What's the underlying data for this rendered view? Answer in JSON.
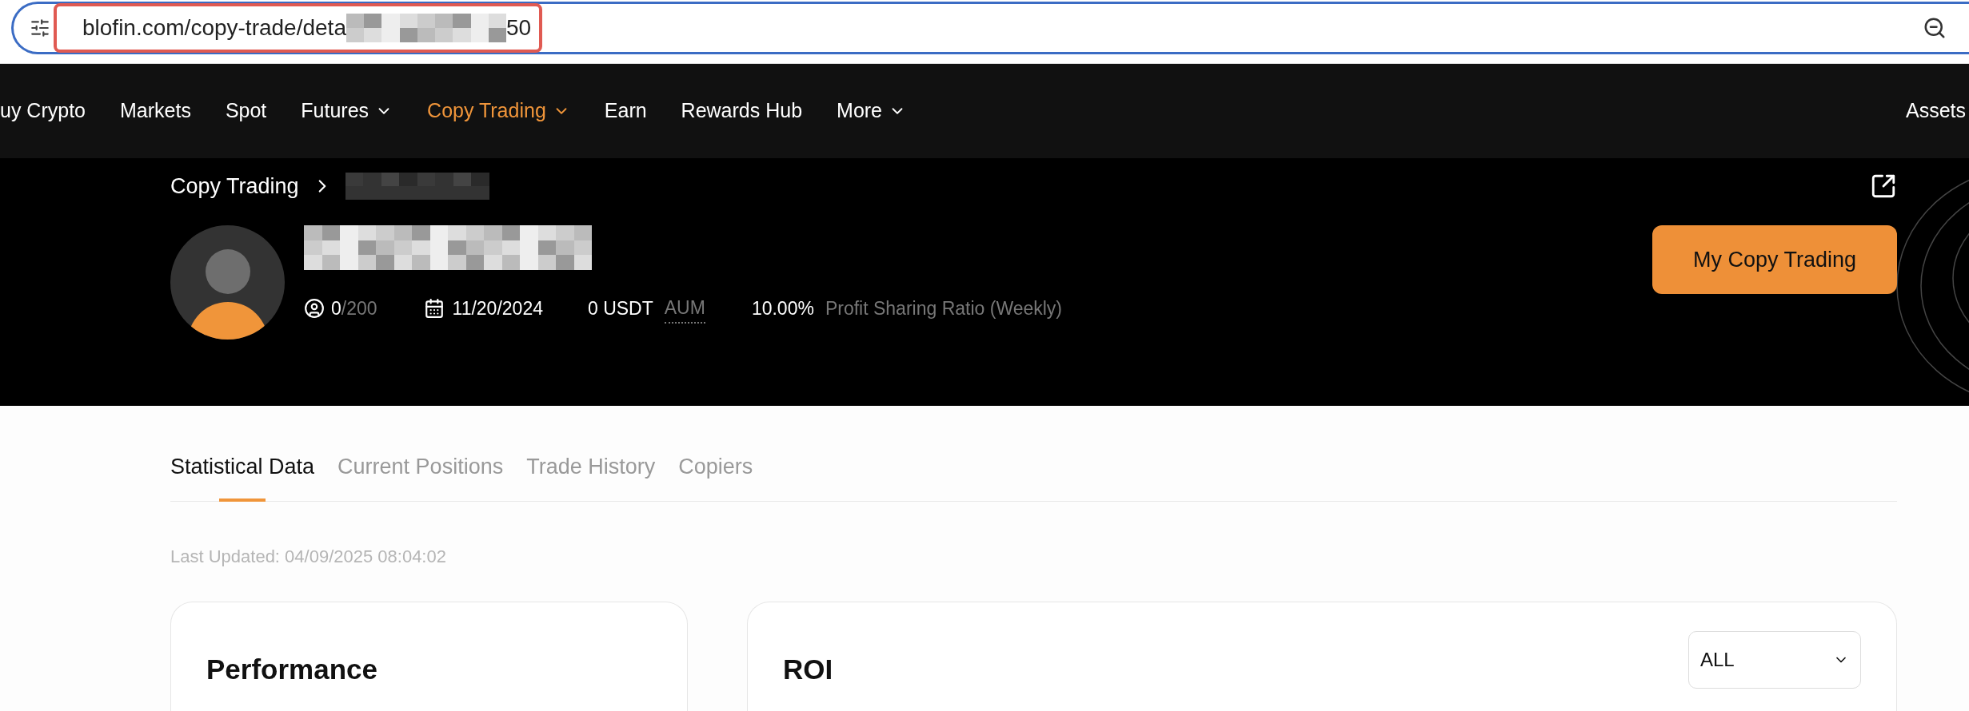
{
  "address_bar": {
    "url_start": "blofin.com/copy-trade/deta",
    "url_end": "50",
    "highlighted": true
  },
  "nav": {
    "items": [
      {
        "label": "uy Crypto",
        "dropdown": false,
        "selected": false
      },
      {
        "label": "Markets",
        "dropdown": false,
        "selected": false
      },
      {
        "label": "Spot",
        "dropdown": false,
        "selected": false
      },
      {
        "label": "Futures",
        "dropdown": true,
        "selected": false
      },
      {
        "label": "Copy Trading",
        "dropdown": true,
        "selected": true
      },
      {
        "label": "Earn",
        "dropdown": false,
        "selected": false
      },
      {
        "label": "Rewards Hub",
        "dropdown": false,
        "selected": false
      },
      {
        "label": "More",
        "dropdown": true,
        "selected": false
      }
    ],
    "right_label": "Assets"
  },
  "breadcrumb": {
    "root": "Copy Trading"
  },
  "profile": {
    "followers": "0",
    "followers_max": "/200",
    "date": "11/20/2024",
    "aum_value": "0 USDT",
    "aum_label": "AUM",
    "profit_share": "10.00%",
    "profit_share_label": "Profit Sharing Ratio (Weekly)"
  },
  "primary_button": "My Copy Trading",
  "tabs": [
    {
      "label": "Statistical Data",
      "selected": true
    },
    {
      "label": "Current Positions",
      "selected": false
    },
    {
      "label": "Trade History",
      "selected": false
    },
    {
      "label": "Copiers",
      "selected": false
    }
  ],
  "last_updated": "Last Updated: 04/09/2025 08:04:02",
  "cards": [
    {
      "title": "Performance"
    },
    {
      "title": "ROI",
      "select": {
        "value": "ALL"
      }
    }
  ]
}
